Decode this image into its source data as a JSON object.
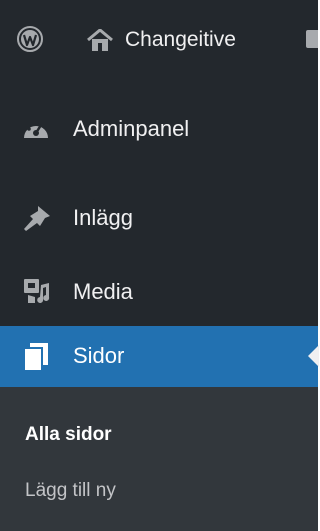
{
  "adminbar": {
    "site_name": "Changeitive",
    "icons": [
      "wordpress-logo-icon",
      "home-icon",
      "comment-bubble-icon"
    ]
  },
  "menu": {
    "items": [
      {
        "label": "Adminpanel",
        "icon": "dashboard-gauge-icon"
      },
      {
        "label": "Inlägg",
        "icon": "pushpin-icon"
      },
      {
        "label": "Media",
        "icon": "media-icon"
      },
      {
        "label": "Sidor",
        "icon": "pages-icon",
        "current": true
      }
    ],
    "submenu": [
      {
        "label": "Alla sidor",
        "current": true
      },
      {
        "label": "Lägg till ny"
      }
    ]
  },
  "colors": {
    "sidebar_bg": "#23282d",
    "submenu_bg": "#32373c",
    "current_bg": "#2271b1",
    "text": "#f0f0f1"
  }
}
